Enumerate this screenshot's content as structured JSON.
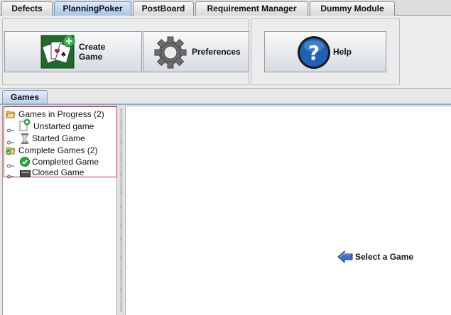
{
  "module_tabs": [
    {
      "label": "Defects",
      "active": false
    },
    {
      "label": "PlanningPoker",
      "active": true
    },
    {
      "label": "PostBoard",
      "active": false
    },
    {
      "label": "Requirement Manager",
      "active": false
    },
    {
      "label": "Dummy Module",
      "active": false
    }
  ],
  "toolbar": {
    "create_game_label_line1": "Create",
    "create_game_label_line2": "Game",
    "preferences_label": "Preferences",
    "help_label": "Help",
    "create_game_icon": "playing-cards-add-icon",
    "preferences_icon": "gear-icon",
    "help_icon": "question-mark-icon"
  },
  "view_tab": {
    "label": "Games"
  },
  "tree": {
    "in_progress": {
      "label": "Games in Progress (2)",
      "icon": "folder-open-icon"
    },
    "unstarted": {
      "label": "Unstarted game",
      "icon": "document-add-icon"
    },
    "started": {
      "label": "Started Game",
      "icon": "hourglass-icon"
    },
    "complete": {
      "label": "Complete Games (2)",
      "icon": "folder-check-icon"
    },
    "completed": {
      "label": "Completed Game",
      "icon": "green-check-icon"
    },
    "closed": {
      "label": "Closed Game",
      "icon": "closed-box-icon"
    }
  },
  "main": {
    "select_hint": "Select a Game",
    "select_hint_icon": "arrow-left-icon"
  },
  "colors": {
    "active_tab": "#a9c4e6",
    "selection_border": "#d22a2a",
    "help_blue": "#1f5fb4",
    "check_green": "#2aa53a"
  }
}
